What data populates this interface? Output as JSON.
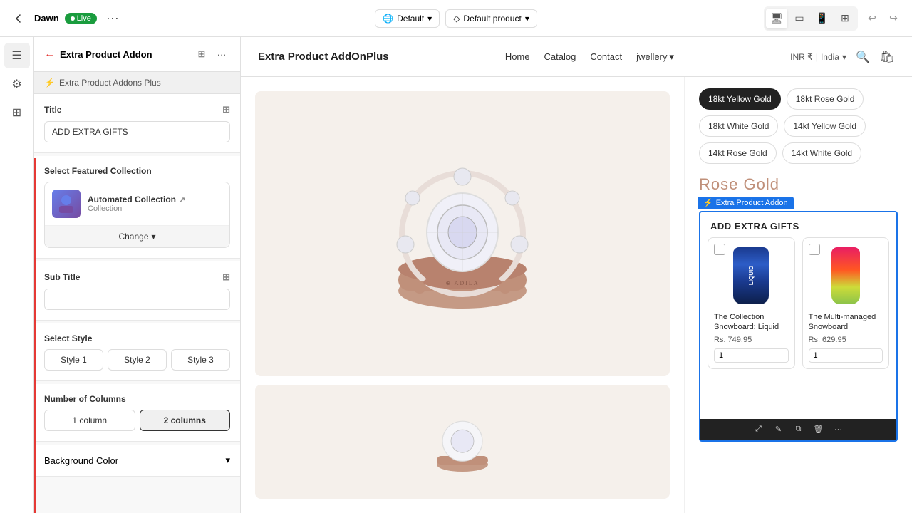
{
  "topbar": {
    "store_name": "Dawn",
    "live_label": "Live",
    "more_label": "...",
    "default_theme": "Default",
    "default_product": "Default product",
    "undo_label": "↩",
    "redo_label": "↪"
  },
  "sidebar_icons": [
    "☰",
    "⚙",
    "⊞"
  ],
  "left_panel": {
    "title": "Extra Product Addon",
    "sub_title": "Extra Product Addons Plus",
    "title_section": {
      "label": "Title",
      "value": "ADD EXTRA GIFTS"
    },
    "collection_section": {
      "label": "Select Featured Collection",
      "collection_name": "Automated Collection",
      "collection_type": "Collection",
      "link_icon": "↗",
      "change_label": "Change"
    },
    "subtitle_section": {
      "label": "Sub Title",
      "placeholder": ""
    },
    "style_section": {
      "label": "Select Style",
      "styles": [
        "Style 1",
        "Style 2",
        "Style 3"
      ]
    },
    "columns_section": {
      "label": "Number of Columns",
      "options": [
        "1 column",
        "2 columns"
      ]
    },
    "background_section": {
      "label": "Background Color"
    }
  },
  "store": {
    "logo": "Extra Product AddOnPlus",
    "nav_links": [
      "Home",
      "Catalog",
      "Contact"
    ],
    "nav_dropdown": "jwellery",
    "currency": "INR ₹",
    "region": "India"
  },
  "product": {
    "gold_options": [
      {
        "label": "18kt Yellow Gold",
        "active": true
      },
      {
        "label": "18kt Rose Gold",
        "active": false
      },
      {
        "label": "18kt White Gold",
        "active": false
      },
      {
        "label": "14kt Yellow Gold",
        "active": false
      },
      {
        "label": "14kt Rose Gold",
        "active": false
      },
      {
        "label": "14kt White Gold",
        "active": false
      }
    ],
    "rose_gold_text": "Rose Gold"
  },
  "addon_panel": {
    "label": "Extra Product Addon",
    "header": "ADD EXTRA GIFTS",
    "products": [
      {
        "name": "The Collection Snowboard: Liquid",
        "price": "Rs. 749.95",
        "qty": "1"
      },
      {
        "name": "The Multi-managed Snowboard",
        "price": "Rs. 629.95",
        "qty": "1"
      }
    ]
  }
}
